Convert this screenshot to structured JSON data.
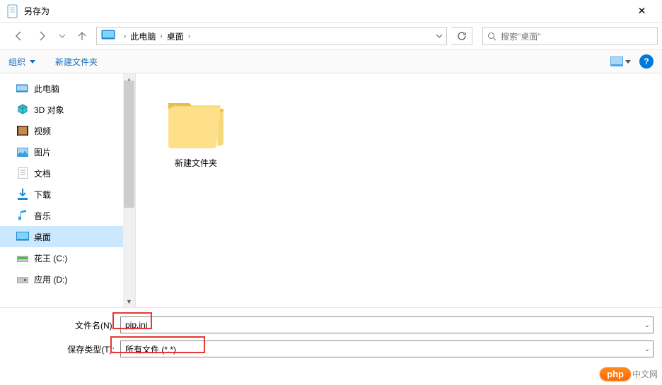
{
  "window": {
    "title": "另存为"
  },
  "breadcrumb": {
    "root": "此电脑",
    "current": "桌面"
  },
  "search": {
    "placeholder": "搜索\"桌面\""
  },
  "toolbar": {
    "organize": "组织",
    "new_folder": "新建文件夹"
  },
  "sidebar": {
    "items": [
      {
        "label": "此电脑",
        "icon": "pc"
      },
      {
        "label": "3D 对象",
        "icon": "3d"
      },
      {
        "label": "视频",
        "icon": "video"
      },
      {
        "label": "图片",
        "icon": "image"
      },
      {
        "label": "文档",
        "icon": "doc"
      },
      {
        "label": "下载",
        "icon": "download"
      },
      {
        "label": "音乐",
        "icon": "music"
      },
      {
        "label": "桌面",
        "icon": "desktop",
        "selected": true
      },
      {
        "label": "花王 (C:)",
        "icon": "drive"
      },
      {
        "label": "应用 (D:)",
        "icon": "drive"
      }
    ]
  },
  "content": {
    "folder_name": "新建文件夹"
  },
  "form": {
    "filename_label": "文件名(N):",
    "filename_value": "pip.ini",
    "filetype_label": "保存类型(T):",
    "filetype_value": "所有文件  (*.*)"
  },
  "watermark": {
    "badge": "php",
    "text": "中文网"
  }
}
